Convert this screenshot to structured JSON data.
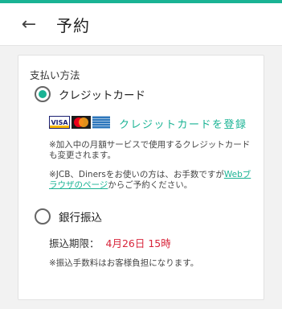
{
  "colors": {
    "accent": "#1ab394",
    "deadline": "#d8253b"
  },
  "header": {
    "back_icon": "arrow-left",
    "back_glyph": "←",
    "title": "予約"
  },
  "payment": {
    "section_label": "支払い方法",
    "credit": {
      "label": "クレジットカード",
      "selected": true,
      "brands": [
        "VISA",
        "Mastercard",
        "American Express"
      ],
      "visa_mark": "VISA",
      "register_link": "クレジットカードを登録",
      "note1": "※加入中の月額サービスで使用するクレジットカードも変更されます。",
      "note2_prefix": "※JCB、Dinersをお使いの方は、お手数ですが",
      "note2_link": "Webブラウザのページ",
      "note2_suffix": "からご予約ください。"
    },
    "bank": {
      "label": "銀行振込",
      "selected": false,
      "deadline_label": "振込期限：",
      "deadline_value": "4月26日 15時",
      "fee_note": "※振込手数料はお客様負担になります。"
    }
  }
}
